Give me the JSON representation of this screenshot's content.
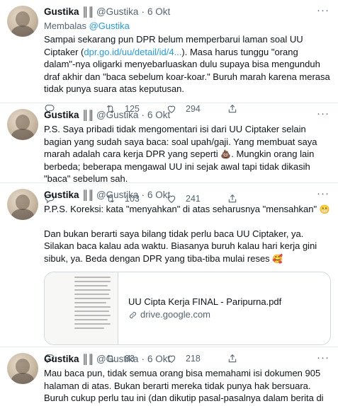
{
  "user": {
    "name": "Gustika",
    "badge": "║║",
    "handle": "@Gustika",
    "sep": "·",
    "time": "6 Okt"
  },
  "more_glyph": "···",
  "tweets": [
    {
      "reply_prefix": "Membalas ",
      "reply_handle": "@Gustika",
      "text_a": "Sampai sekarang pun DPR belum memperbarui laman soal UU Ciptaker (",
      "link": "dpr.go.id/uu/detail/id/4...",
      "text_b": "). Masa harus tunggu \"orang dalam\"-nya oligarki menyebarluaskan dulu supaya bisa mengunduh draf akhir dan \"baca sebelum koar-koar.\" Buruh marah karena merasa tidak punya suara atas keputusan.",
      "retweets": "125",
      "likes": "294"
    },
    {
      "text_a": "P.S. Saya pribadi tidak mengomentari isi dari UU Ciptaker selain bagian yang sudah saya baca: soal upah/gaji. Yang membuat saya marah adalah cara kerja DPR yang seperti ",
      "emoji": "💩",
      "text_b": ". Mungkin orang lain berbeda; beberapa mengawal UU ini sejak awal tapi tidak dikasih \"baca\" sebelum sah.",
      "retweets": "103",
      "likes": "241"
    },
    {
      "p1": "P.P.S. Koreksi: kata \"menyahkan\" di atas seharusnya \"mensahkan\" ",
      "emoji1": "😬",
      "p2": "Dan bukan berarti saya bilang tidak perlu baca UU Ciptaker, ya. Silakan baca kalau ada waktu. Biasanya buruh kalau hari kerja gini sibuk, ya. Beda dengan DPR yang tiba-tiba mulai reses ",
      "emoji2": "🥰",
      "card_title": "UU Cipta Kerja FINAL - Paripurna.pdf",
      "card_domain": "drive.google.com",
      "retweets": "83",
      "likes": "218"
    },
    {
      "text": "Mau baca pun, tidak semua orang bisa memahami isi dokumen 905 halaman di atas. Bukan berarti mereka tidak punya hak bersuara. Buruh cukup perlu tau ini (dan dikutip pasal-pasalnya dalam berita di bawah):"
    }
  ]
}
